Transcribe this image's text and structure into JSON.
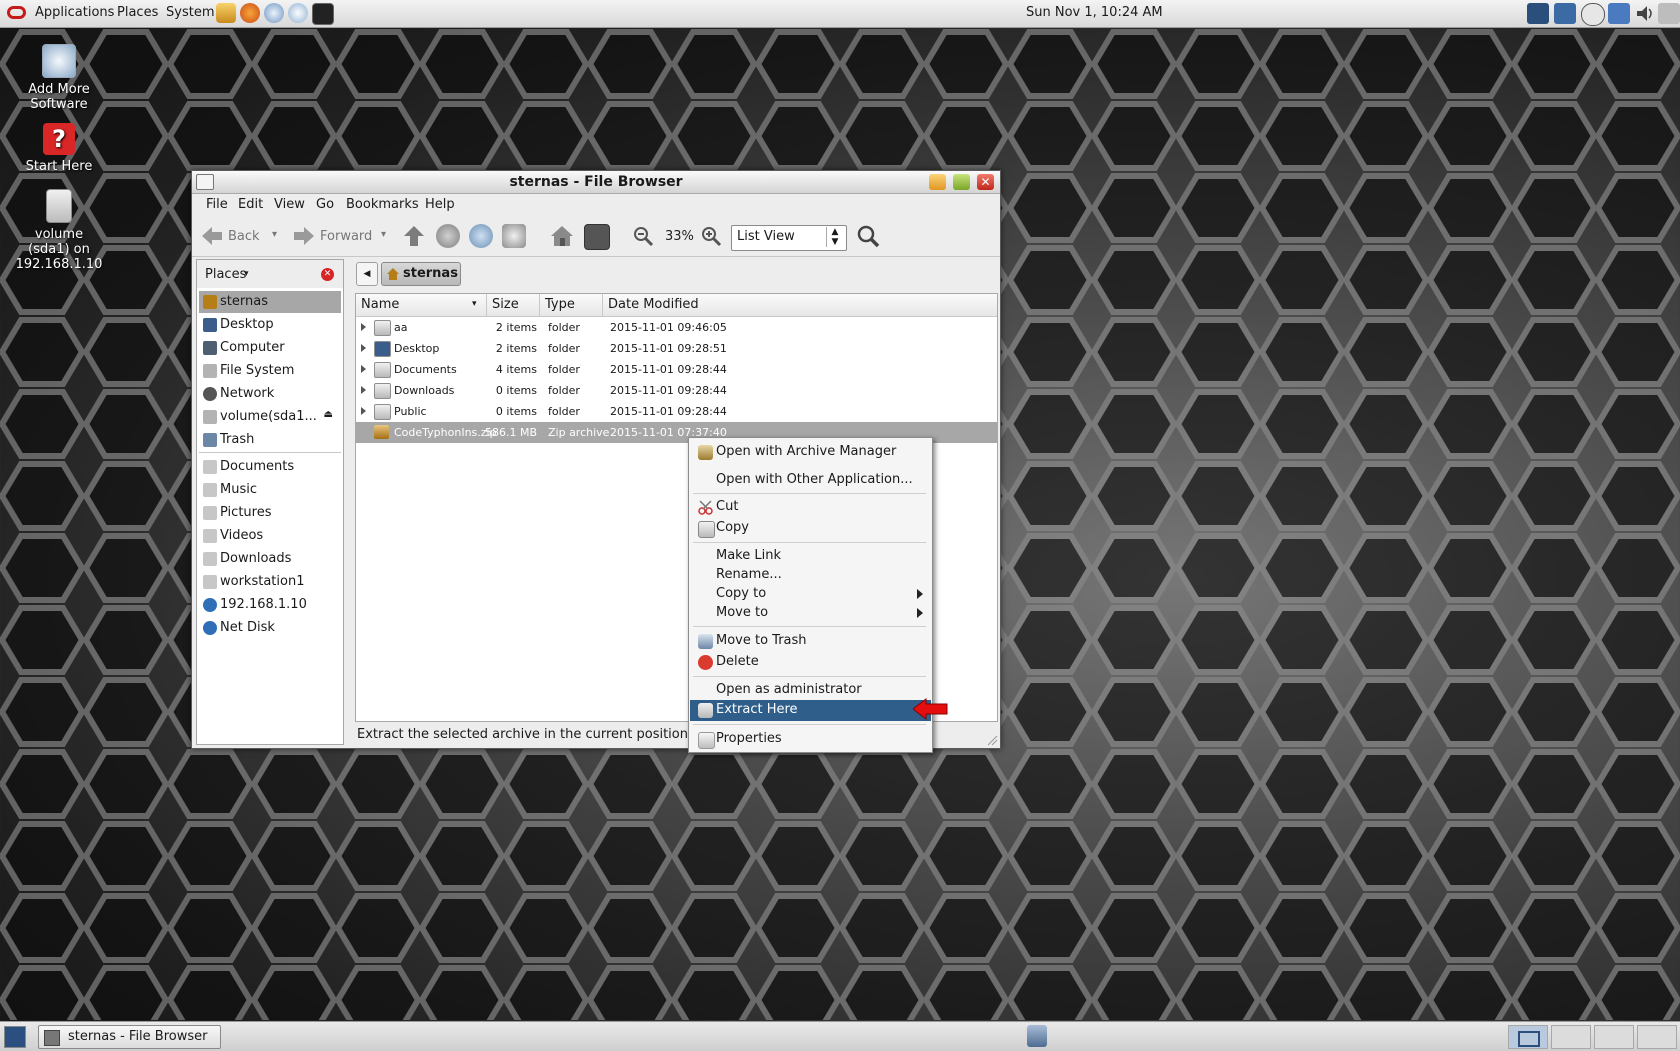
{
  "top_panel": {
    "menus": [
      "Applications",
      "Places",
      "System"
    ],
    "clock": "Sun Nov  1, 10:24 AM"
  },
  "desktop_icons": [
    {
      "label": "Add More Software"
    },
    {
      "label": "Start Here"
    },
    {
      "label": "volume (sda1) on 192.168.1.10"
    }
  ],
  "window": {
    "title": "sternas - File Browser",
    "menubar": [
      "File",
      "Edit",
      "View",
      "Go",
      "Bookmarks",
      "Help"
    ],
    "toolbar": {
      "back_label": "Back",
      "forward_label": "Forward",
      "zoom_level": "33%",
      "view_mode": "List View"
    },
    "sidebar": {
      "header": "Places",
      "items": [
        {
          "label": "sternas",
          "icon": "home-icon",
          "selected": true
        },
        {
          "label": "Desktop",
          "icon": "desktop-icon"
        },
        {
          "label": "Computer",
          "icon": "computer-icon"
        },
        {
          "label": "File System",
          "icon": "drive-icon"
        },
        {
          "label": "Network",
          "icon": "network-icon"
        },
        {
          "label": "volume(sda1...",
          "icon": "drive-icon"
        },
        {
          "label": "Trash",
          "icon": "trash-icon"
        },
        {
          "label": "Documents",
          "icon": "folder-icon"
        },
        {
          "label": "Music",
          "icon": "folder-icon"
        },
        {
          "label": "Pictures",
          "icon": "folder-icon"
        },
        {
          "label": "Videos",
          "icon": "folder-icon"
        },
        {
          "label": "Downloads",
          "icon": "folder-icon"
        },
        {
          "label": "workstation1",
          "icon": "folder-icon"
        },
        {
          "label": "192.168.1.10",
          "icon": "network-share-icon"
        },
        {
          "label": "Net Disk",
          "icon": "network-share-icon"
        }
      ]
    },
    "breadcrumb": "sternas",
    "columns": [
      "Name",
      "Size",
      "Type",
      "Date Modified"
    ],
    "files": [
      {
        "name": "aa",
        "size": "2 items",
        "type": "folder",
        "modified": "2015-11-01 09:46:05"
      },
      {
        "name": "Desktop",
        "size": "2 items",
        "type": "folder",
        "modified": "2015-11-01 09:28:51"
      },
      {
        "name": "Documents",
        "size": "4 items",
        "type": "folder",
        "modified": "2015-11-01 09:28:44"
      },
      {
        "name": "Downloads",
        "size": "0 items",
        "type": "folder",
        "modified": "2015-11-01 09:28:44"
      },
      {
        "name": "Public",
        "size": "0 items",
        "type": "folder",
        "modified": "2015-11-01 09:28:44"
      },
      {
        "name": "CodeTyphonIns.zip",
        "size": "586.1 MB",
        "type": "Zip archive",
        "modified": "2015-11-01 07:37:40"
      }
    ],
    "status": "Extract the selected archive in the current position"
  },
  "context_menu": [
    {
      "label": "Open with Archive Manager"
    },
    {
      "label": "Open with Other Application..."
    },
    {
      "label": "Cut"
    },
    {
      "label": "Copy"
    },
    {
      "label": "Make Link"
    },
    {
      "label": "Rename..."
    },
    {
      "label": "Copy to"
    },
    {
      "label": "Move to"
    },
    {
      "label": "Move to Trash"
    },
    {
      "label": "Delete"
    },
    {
      "label": "Open as administrator"
    },
    {
      "label": "Extract Here"
    },
    {
      "label": "Properties"
    }
  ],
  "taskbar": {
    "task": "sternas - File Browser"
  }
}
